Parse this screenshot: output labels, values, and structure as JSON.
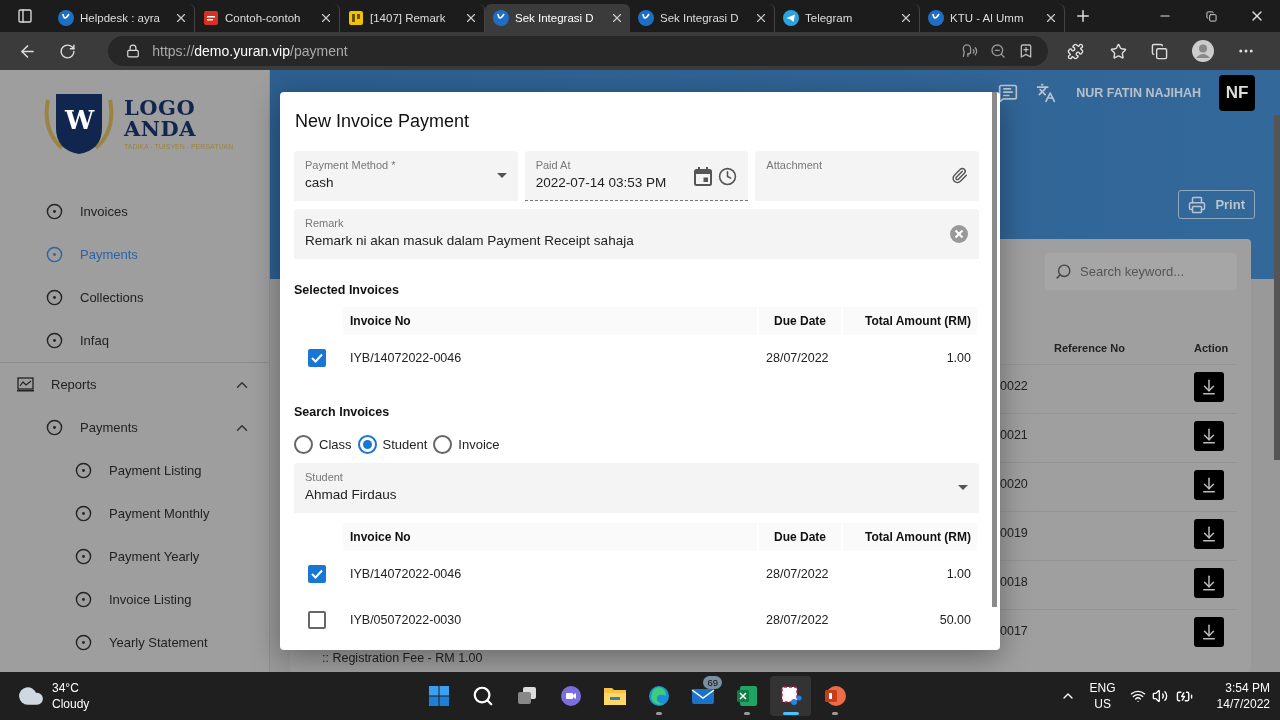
{
  "browser": {
    "tabs": [
      {
        "kind": "yuran",
        "title": "Helpdesk : ayra",
        "selected": false
      },
      {
        "kind": "pdf",
        "title": "Contoh-contoh",
        "selected": false
      },
      {
        "kind": "note",
        "title": "[1407] Remark",
        "selected": false
      },
      {
        "kind": "yuran",
        "title": "Sek Integrasi D",
        "selected": true
      },
      {
        "kind": "yuran",
        "title": "Sek Integrasi D",
        "selected": false
      },
      {
        "kind": "telegram",
        "title": "Telegram",
        "selected": false
      },
      {
        "kind": "yuran",
        "title": "KTU - Al Umm",
        "selected": false
      }
    ],
    "address": {
      "scheme": "https://",
      "host": "demo.yuran.vip",
      "path": "/payment"
    }
  },
  "sidebar": {
    "logo": {
      "letter": "W",
      "line_1": "LOGO",
      "line_2": "ANDA",
      "tagline": "TADIKA - TUISYEN - PERSATUAN"
    },
    "items": [
      {
        "label": "Invoices",
        "selected": false
      },
      {
        "label": "Payments",
        "selected": true
      },
      {
        "label": "Collections",
        "selected": false
      },
      {
        "label": "Infaq",
        "selected": false
      }
    ],
    "sections": [
      {
        "label": "Reports",
        "expanded": true,
        "children": [
          {
            "label": "Payments",
            "expanded": true,
            "selected": false,
            "children": [
              {
                "label": "Payment Listing",
                "selected": false
              },
              {
                "label": "Payment Monthly",
                "selected": false
              },
              {
                "label": "Payment Yearly",
                "selected": false
              },
              {
                "label": "Invoice Listing",
                "selected": false
              },
              {
                "label": "Yearly Statement",
                "selected": false
              }
            ]
          }
        ]
      }
    ]
  },
  "header": {
    "user_name": "NUR FATIN NAJIHAH",
    "avatar": "NF",
    "print_button": "Print"
  },
  "list": {
    "search_placeholder": "Search keyword...",
    "columns": [
      "Reference No",
      "Action"
    ],
    "rows": [
      {
        "column_1": "0022"
      },
      {
        "column_1": "0021"
      },
      {
        "column_1": "0020"
      },
      {
        "column_1": "0019"
      },
      {
        "column_1": "0018"
      },
      {
        "column_1": "0017",
        "note": ":: Registration Fee - RM 1.00"
      }
    ]
  },
  "dialog": {
    "title": "New Invoice Payment",
    "payment_method": {
      "label": "Payment Method *",
      "value": "cash"
    },
    "paid_at": {
      "label": "Paid At",
      "value": "2022-07-14 03:53 PM"
    },
    "attachment": {
      "label": "Attachment"
    },
    "remark": {
      "label": "Remark",
      "value": "Remark ni akan masuk dalam Payment Receipt sahaja"
    },
    "selected_invoices": {
      "title": "Selected Invoices",
      "columns": [
        "Invoice No",
        "Due Date",
        "Total Amount (RM)"
      ],
      "rows": [
        {
          "checked": true,
          "invoice_no": "IYB/14072022-0046",
          "due_date": "28/07/2022",
          "amount": "1.00"
        }
      ]
    },
    "search_invoices": {
      "title": "Search Invoices",
      "options": [
        {
          "label": "Class",
          "selected": false
        },
        {
          "label": "Student",
          "selected": true
        },
        {
          "label": "Invoice",
          "selected": false
        }
      ],
      "student": {
        "label": "Student",
        "value": "Ahmad Firdaus"
      },
      "columns": [
        "Invoice No",
        "Due Date",
        "Total Amount (RM)"
      ],
      "rows": [
        {
          "checked": true,
          "invoice_no": "IYB/14072022-0046",
          "due_date": "28/07/2022",
          "amount": "1.00"
        },
        {
          "checked": false,
          "invoice_no": "IYB/05072022-0030",
          "due_date": "28/07/2022",
          "amount": "50.00"
        }
      ]
    }
  },
  "taskbar": {
    "weather": {
      "temperature": "34°C",
      "condition": "Cloudy"
    },
    "apps": [
      {
        "kind": "start",
        "running": false,
        "active": false
      },
      {
        "kind": "search",
        "running": false,
        "active": false
      },
      {
        "kind": "taskview",
        "running": false,
        "active": false
      },
      {
        "kind": "chat",
        "running": false,
        "active": false
      },
      {
        "kind": "explorer",
        "running": false,
        "active": false
      },
      {
        "kind": "edge",
        "running": true,
        "active": false
      },
      {
        "kind": "mail",
        "running": false,
        "active": false,
        "badge": "69"
      },
      {
        "kind": "excel",
        "running": true,
        "active": false
      },
      {
        "kind": "snip",
        "running": true,
        "active": true
      },
      {
        "kind": "powerpoint",
        "running": true,
        "active": false
      }
    ],
    "language": "ENG",
    "region": "US",
    "time": "3:54 PM",
    "date": "14/7/2022"
  }
}
